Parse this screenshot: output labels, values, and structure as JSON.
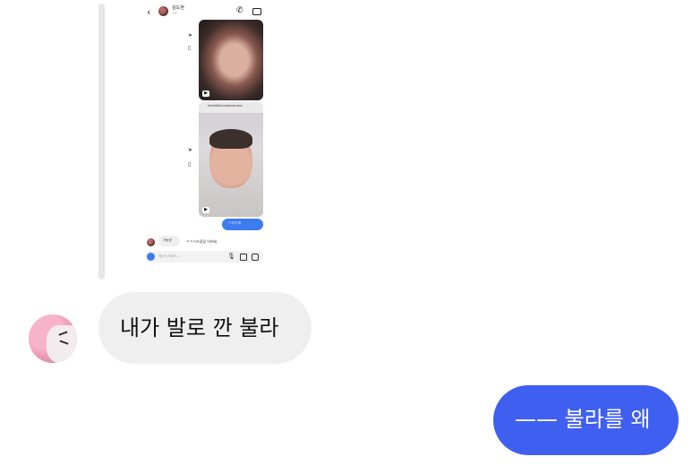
{
  "shared_screenshot": {
    "contact_name": "김도현",
    "contact_sub": "_kd",
    "reel_username": "markfolio.bookversion",
    "sent_message": "ㄱ 이거 봐",
    "received_reply": "가능성",
    "received_text": "ㅋㅋㅋ쓰달달 아저씨",
    "compose_placeholder": "메시지 보내기..."
  },
  "chat": {
    "received_message": "내가 발로 깐 불라",
    "sent_message": "—— 불라를 왜"
  },
  "colors": {
    "sent_bubble": "#3f5ff0",
    "received_bubble": "#efefef",
    "quote_bar": "#e6e6e6"
  },
  "icons": [
    "back-icon",
    "phone-icon",
    "video-icon",
    "send-icon",
    "bookmark-icon",
    "reel-icon",
    "camera-icon",
    "mic-icon",
    "gallery-icon",
    "sticker-icon"
  ]
}
